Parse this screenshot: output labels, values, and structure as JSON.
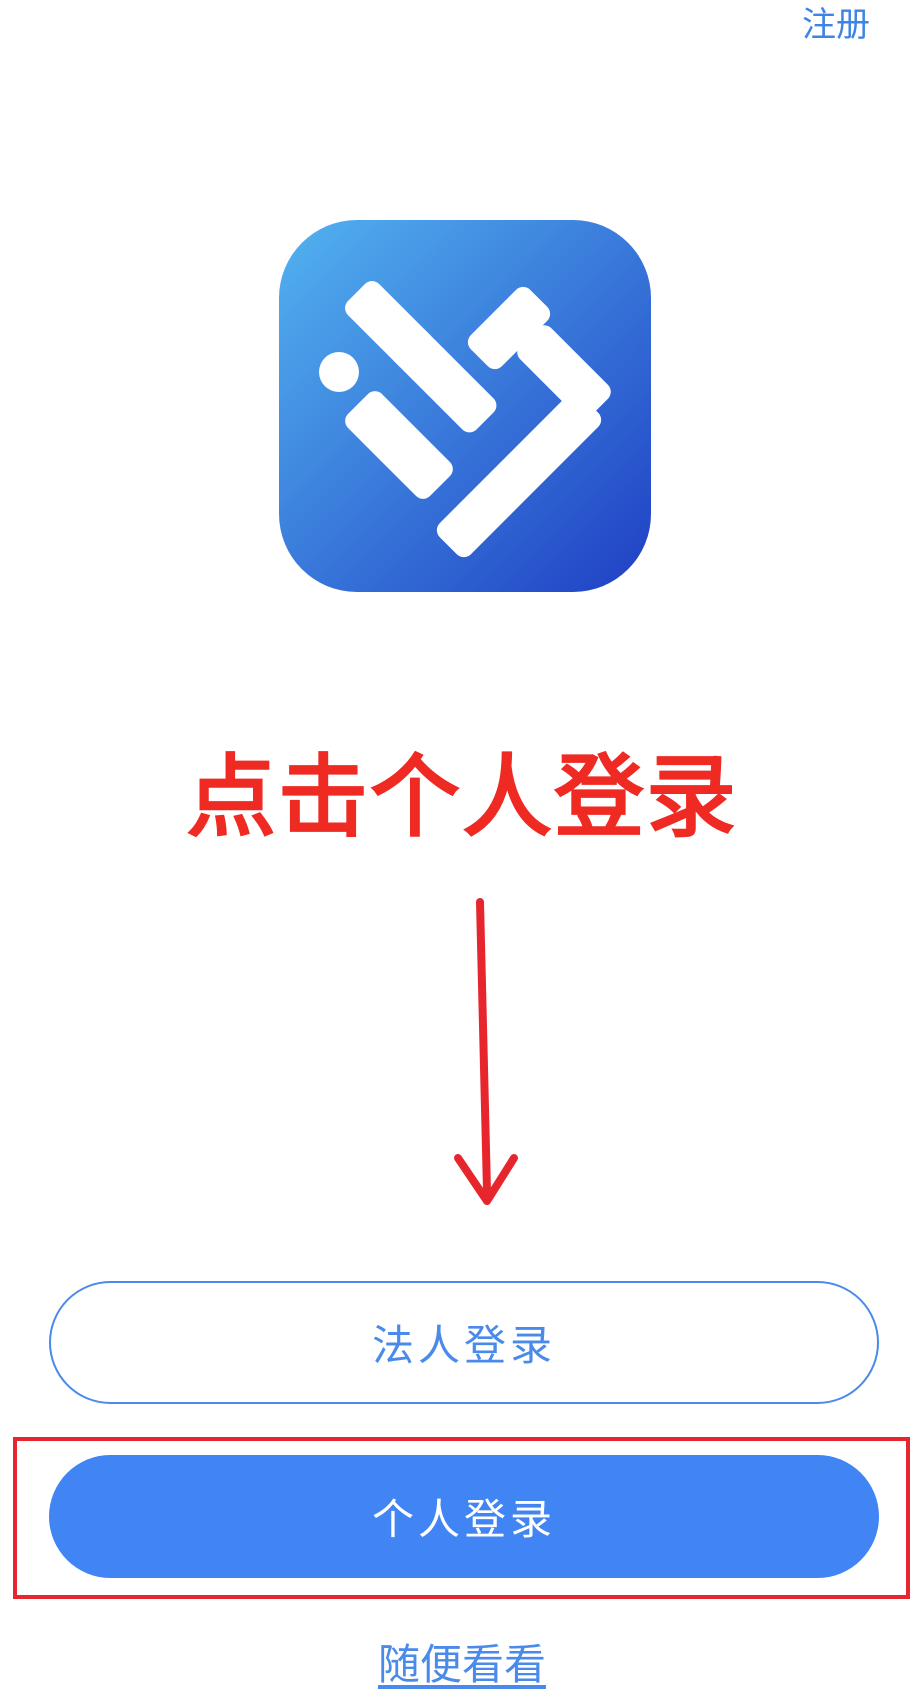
{
  "header": {
    "register_label": "注册"
  },
  "logo": {
    "icon": "heart-check-logo-icon",
    "gradient_start": "#53b3f0",
    "gradient_end": "#1f3fc4"
  },
  "annotation": {
    "instruction_text": "点击个人登录",
    "color": "#ee2a22"
  },
  "actions": {
    "legal_login_label": "法人登录",
    "personal_login_label": "个人登录",
    "browse_label": "随便看看"
  },
  "colors": {
    "accent": "#4185f4",
    "link": "#3d84e4"
  }
}
